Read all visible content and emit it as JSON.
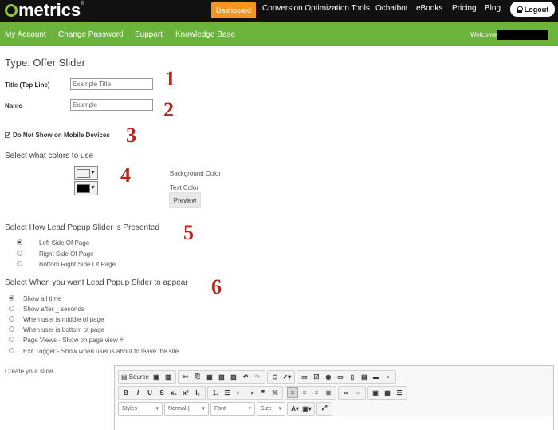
{
  "header": {
    "logo_text": "metrics",
    "logo_mark": "®",
    "dashboard_label": "Dashboard",
    "nav": [
      "Conversion Optimization Tools",
      "Ochatbot",
      "eBooks",
      "Pricing",
      "Blog"
    ],
    "logout_label": "Logout"
  },
  "subnav": {
    "items": [
      "My Account",
      "Change Password",
      "Support",
      "Knowledge Base"
    ],
    "welcome": "Welcome"
  },
  "form": {
    "type_title": "Type: Offer Slider",
    "title_label": "Title (Top Line)",
    "title_value": "Example Title",
    "name_label": "Name",
    "name_value": "Example",
    "mobile_label": "Do Not Show on Mobile Devices",
    "mobile_checked": true,
    "colors_heading": "Select what colors to use",
    "bg_color_label": "Background Color",
    "text_color_label": "Text Color",
    "bg_color": "#f2f2f2",
    "text_color": "#000000",
    "preview_label": "Preview",
    "presented_heading": "Select How Lead Popup Slider is Presented",
    "presented_options": [
      "Left Side Of Page",
      "Right Side Of Page",
      "Bottom Right Side Of Page"
    ],
    "presented_selected": 0,
    "appear_heading": "Select When you want Lead Popup Slider to appear",
    "appear_options": [
      "Show all time",
      "Show after _ seconds",
      "When user is middle of page",
      "When user is bottom of page",
      "Page Views - Show on page view #",
      "Exit Trigger - Show when user is about to leave the site"
    ],
    "appear_selected": 0,
    "create_label": "Create your slide"
  },
  "markers": [
    "1",
    "2",
    "3",
    "4",
    "5",
    "6"
  ],
  "editor": {
    "source_label": "Source",
    "styles_label": "Styles",
    "format_label": "Normal (",
    "font_label": "Font",
    "size_label": "Size"
  },
  "colors": {
    "topbar": "#111111",
    "greenbar": "#6bb33a",
    "dashboard": "#f7941d",
    "marker": "#b3261e"
  }
}
